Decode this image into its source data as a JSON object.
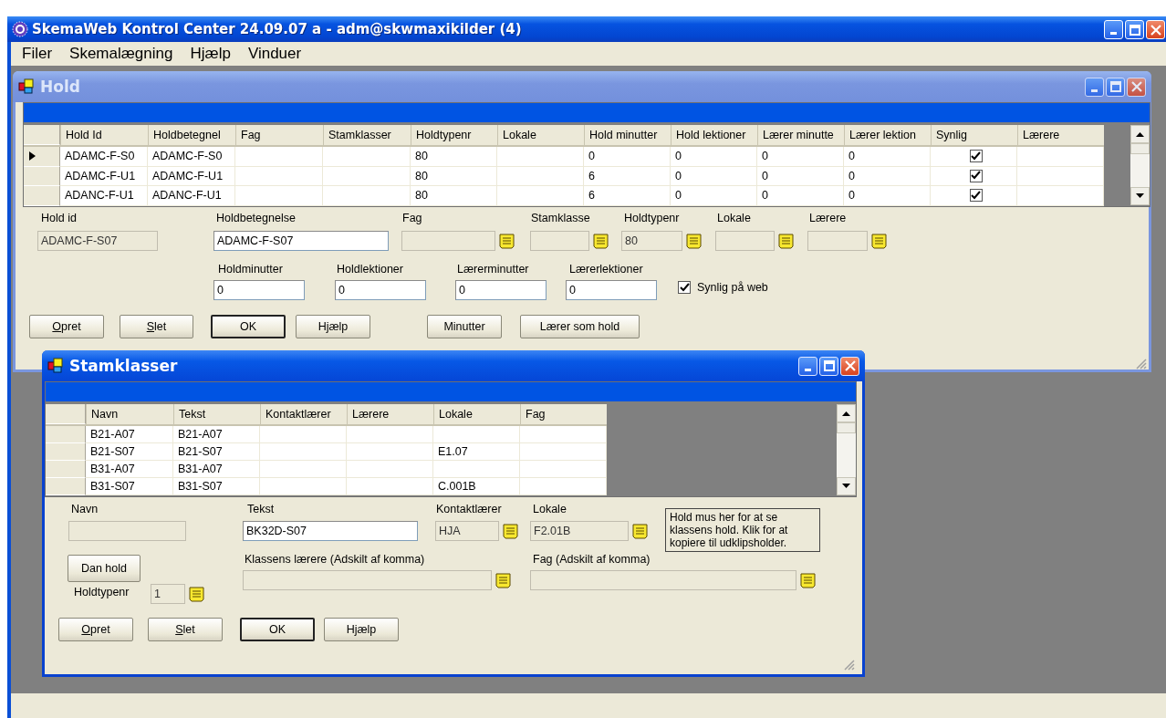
{
  "window": {
    "title": "SkemaWeb Kontrol Center 24.09.07 a - adm@skwmaxikilder (4)"
  },
  "menu": [
    {
      "label": "Filer"
    },
    {
      "label": "Skemalægning"
    },
    {
      "label": "Hjælp"
    },
    {
      "label": "Vinduer"
    }
  ],
  "hold_window": {
    "title": "Hold",
    "active": false,
    "table": {
      "columns": [
        "Hold Id",
        "Holdbetegnel",
        "Fag",
        "Stamklasser",
        "Holdtypenr",
        "Lokale",
        "Hold minutter",
        "Hold lektioner",
        "Lærer minutte",
        "Lærer lektion",
        "Synlig",
        "Lærere"
      ],
      "rows": [
        {
          "current": true,
          "cells": [
            "ADAMC-F-S0",
            "ADAMC-F-S0",
            "",
            "",
            "80",
            "",
            "0",
            "0",
            "0",
            "0"
          ],
          "synlig": true
        },
        {
          "current": false,
          "cells": [
            "ADAMC-F-U1",
            "ADAMC-F-U1",
            "",
            "",
            "80",
            "",
            "6",
            "0",
            "0",
            "0"
          ],
          "synlig": true
        },
        {
          "current": false,
          "cells": [
            "ADANC-F-U1",
            "ADANC-F-U1",
            "",
            "",
            "80",
            "",
            "6",
            "0",
            "0",
            "0"
          ],
          "synlig": true
        }
      ]
    },
    "fields": [
      {
        "label": "Hold id",
        "value": "ADAMC-F-S07",
        "disabled": true
      },
      {
        "label": "Holdbetegnelse",
        "value": "ADAMC-F-S07",
        "disabled": false
      },
      {
        "label": "Fag",
        "disabled": true,
        "picker": true
      },
      {
        "label": "Stamklasse",
        "disabled": true,
        "picker": true
      },
      {
        "label": "Holdtypenr",
        "value": "80",
        "disabled": true,
        "picker": true
      },
      {
        "label": "Lokale",
        "disabled": true,
        "picker": true
      },
      {
        "label": "Lærere",
        "disabled": true,
        "picker": true
      },
      {
        "label": "Holdminutter",
        "value": "0",
        "disabled": false
      },
      {
        "label": "Holdlektioner",
        "value": "0",
        "disabled": false
      },
      {
        "label": "Lærerminutter",
        "value": "0",
        "disabled": false
      },
      {
        "label": "Lærerlektioner",
        "value": "0",
        "disabled": false
      }
    ],
    "checkbox": {
      "label": "Synlig på web",
      "checked": true
    },
    "buttons": [
      {
        "label": "Opret",
        "mnemonic": true,
        "default": false
      },
      {
        "label": "Slet",
        "mnemonic": true,
        "default": false
      },
      {
        "label": "OK",
        "mnemonic": false,
        "default": true
      },
      {
        "label": "Hjælp",
        "mnemonic": false,
        "default": false
      },
      {
        "label": "Minutter",
        "mnemonic": false,
        "default": false
      },
      {
        "label": "Lærer som hold",
        "mnemonic": false,
        "default": false
      }
    ]
  },
  "stamklasser_window": {
    "title": "Stamklasser",
    "active": true,
    "table": {
      "columns": [
        "Navn",
        "Tekst",
        "Kontaktlærer",
        "Lærere",
        "Lokale",
        "Fag"
      ],
      "rows": [
        {
          "cells": [
            "B21-A07",
            "B21-A07",
            "",
            "",
            "",
            ""
          ]
        },
        {
          "cells": [
            "B21-S07",
            "B21-S07",
            "",
            "",
            "E1.07",
            ""
          ]
        },
        {
          "cells": [
            "B31-A07",
            "B31-A07",
            "",
            "",
            "",
            ""
          ]
        },
        {
          "cells": [
            "B31-S07",
            "B31-S07",
            "",
            "",
            "C.001B",
            ""
          ]
        }
      ]
    },
    "fields": [
      {
        "label": "Navn",
        "disabled": true
      },
      {
        "label": "Tekst",
        "value": "BK32D-S07",
        "disabled": false
      },
      {
        "label": "Kontaktlærer",
        "value": "HJA",
        "disabled": true,
        "picker": true
      },
      {
        "label": "Lokale",
        "value": "F2.01B",
        "disabled": true,
        "picker": true
      },
      {
        "label": "Klassens lærere (Adskilt af komma)",
        "disabled": true,
        "picker": true
      },
      {
        "label": "Fag (Adskilt af komma)",
        "disabled": true,
        "picker": true
      },
      {
        "label": "Holdtypenr",
        "value": "1",
        "disabled": true,
        "picker": true
      }
    ],
    "info": [
      "Hold mus her for at se",
      "klassens hold. Klik for at",
      "kopiere til udklipsholder."
    ],
    "side_button": {
      "label": "Dan hold"
    },
    "buttons": [
      {
        "label": "Opret",
        "mnemonic": true,
        "default": false
      },
      {
        "label": "Slet",
        "mnemonic": true,
        "default": false
      },
      {
        "label": "OK",
        "mnemonic": false,
        "default": true
      },
      {
        "label": "Hjælp",
        "mnemonic": false,
        "default": false
      }
    ]
  }
}
